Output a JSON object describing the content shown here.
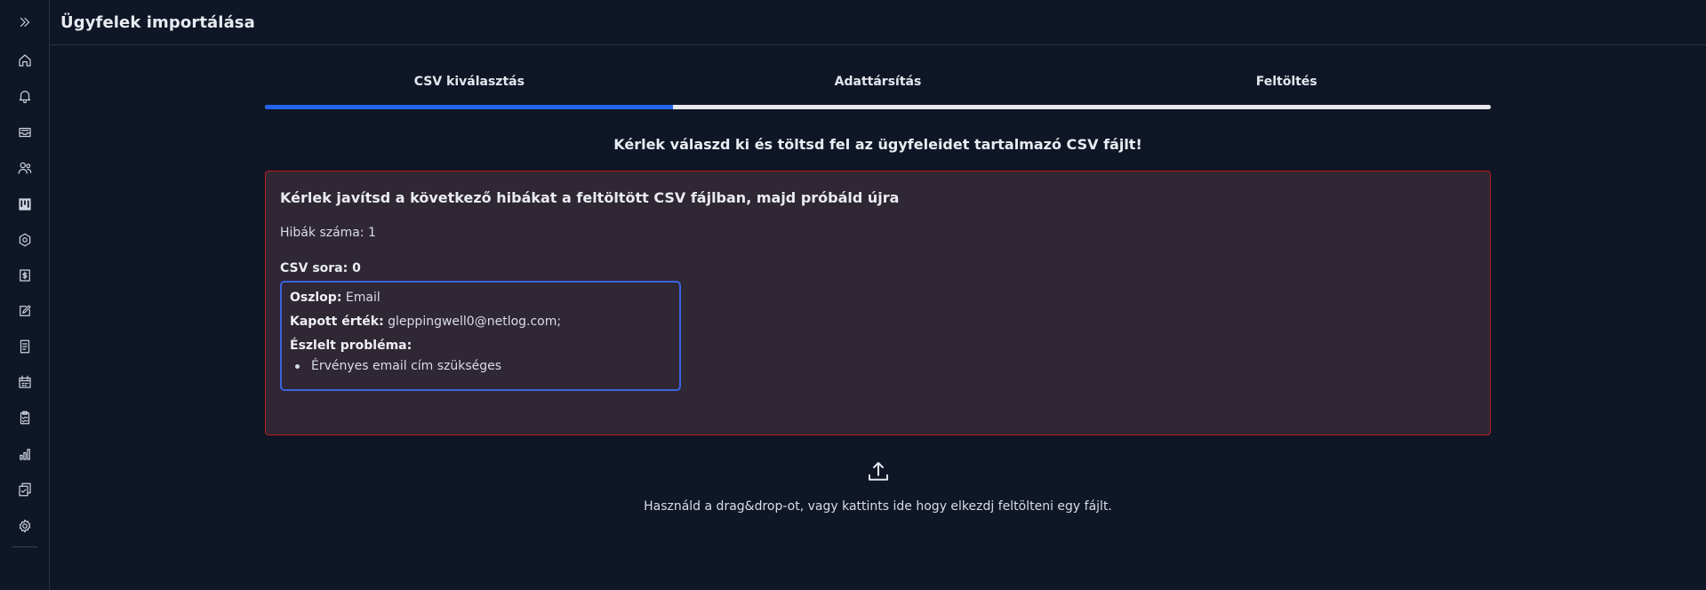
{
  "header": {
    "title": "Ügyfelek importálása"
  },
  "sidebar": {
    "icons": [
      "expand-icon",
      "home-icon",
      "bell-icon",
      "inbox-icon",
      "users-icon",
      "kanban-icon",
      "settings-cog-icon",
      "invoice-icon",
      "edit-icon",
      "document-icon",
      "calendar-icon",
      "checklist-icon",
      "chart-icon",
      "copy-check-icon",
      "gear-icon"
    ]
  },
  "steps": {
    "tabs": [
      {
        "label": "CSV kiválasztás"
      },
      {
        "label": "Adattársítás"
      },
      {
        "label": "Feltöltés"
      }
    ],
    "progress_fraction": 0.333,
    "progress_color": "#2563eb"
  },
  "instruction": "Kérlek válaszd ki és töltsd fel az ügyfeleidet tartalmazó CSV fájlt!",
  "error": {
    "title": "Kérlek javítsd a következő hibákat a feltöltött CSV fájlban, majd próbáld újra",
    "count_text": "Hibák száma: 1",
    "row_label": "CSV sora: 0",
    "column_label": "Oszlop:",
    "column_value": "Email",
    "received_label": "Kapott érték:",
    "received_value": "gleppingwell0@netlog.com;",
    "problem_label": "Észlelt probléma:",
    "problems": [
      "Érvényes email cím szükséges"
    ],
    "border_color": "#b91c1c"
  },
  "upload": {
    "icon": "upload-icon",
    "text": "Használd a drag&drop-ot, vagy kattints ide hogy elkezdj feltölteni egy fájlt."
  }
}
